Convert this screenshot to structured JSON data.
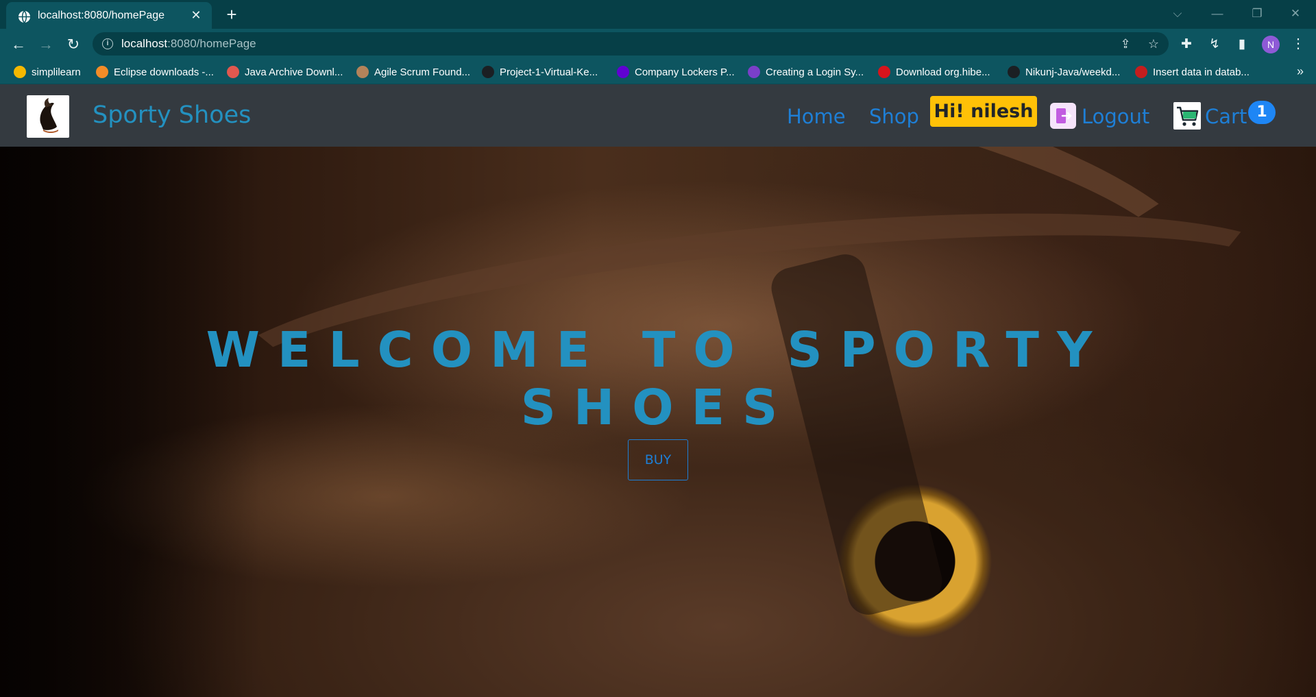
{
  "browser": {
    "tab_title": "localhost:8080/homePage",
    "url_host": "localhost",
    "url_rest": ":8080/homePage",
    "profile_initial": "N"
  },
  "bookmarks": [
    {
      "label": "simplilearn",
      "icon": "simplilearn-icon",
      "color": "#f5b800"
    },
    {
      "label": "Eclipse downloads -...",
      "icon": "eclipse-icon",
      "color": "#f28c28"
    },
    {
      "label": "Java Archive Downl...",
      "icon": "oracle-icon",
      "color": "#e0584f"
    },
    {
      "label": "Agile Scrum Found...",
      "icon": "agile-icon",
      "color": "#b3835a"
    },
    {
      "label": "Project-1-Virtual-Ke...",
      "icon": "github-icon",
      "color": "#1b1f23"
    },
    {
      "label": "Company Lockers P...",
      "icon": "yahoo-icon",
      "color": "#6001d2"
    },
    {
      "label": "Creating a Login Sy...",
      "icon": "st-icon",
      "color": "#7a3fc9"
    },
    {
      "label": "Download org.hibe...",
      "icon": "download-icon",
      "color": "#d6141c"
    },
    {
      "label": "Nikunj-Java/weekd...",
      "icon": "github-icon",
      "color": "#1b1f23"
    },
    {
      "label": "Insert data in datab...",
      "icon": "database-icon",
      "color": "#c41e1e"
    }
  ],
  "nav": {
    "brand": "Sporty Shoes",
    "home": "Home",
    "shop": "Shop",
    "greeting": "Hi! nilesh",
    "logout": "Logout",
    "cart": "Cart",
    "cart_count": "1"
  },
  "hero": {
    "title_line1": "WELCOME TO SPORTY",
    "title_line2": "SHOES",
    "buy_label": "BUY"
  },
  "colors": {
    "brand": "#2391c0",
    "link": "#1e7fd6",
    "greeting_bg": "#ffc107",
    "navbar_bg": "#343a40",
    "badge_bg": "#1e86f5"
  }
}
